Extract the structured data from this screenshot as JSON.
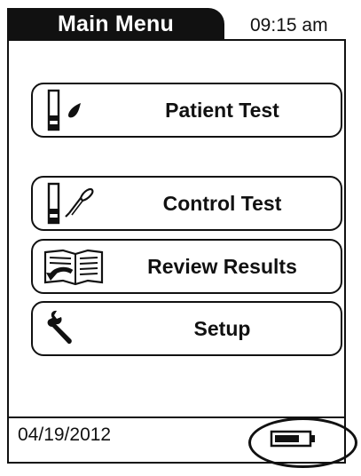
{
  "header": {
    "title": "Main Menu",
    "time": "09:15 am"
  },
  "menu": {
    "items": [
      {
        "label": "Patient Test",
        "icon": "test-strip-drop-icon"
      },
      {
        "label": "Control Test",
        "icon": "test-strip-pipette-icon"
      },
      {
        "label": "Review Results",
        "icon": "book-return-icon"
      },
      {
        "label": "Setup",
        "icon": "wrench-icon"
      }
    ]
  },
  "footer": {
    "date": "04/19/2012",
    "battery": {
      "icon": "battery-icon",
      "level_fraction": 0.75
    }
  },
  "annotation": {
    "icon": "callout-circle"
  },
  "colors": {
    "ink": "#111111",
    "background": "#ffffff"
  }
}
